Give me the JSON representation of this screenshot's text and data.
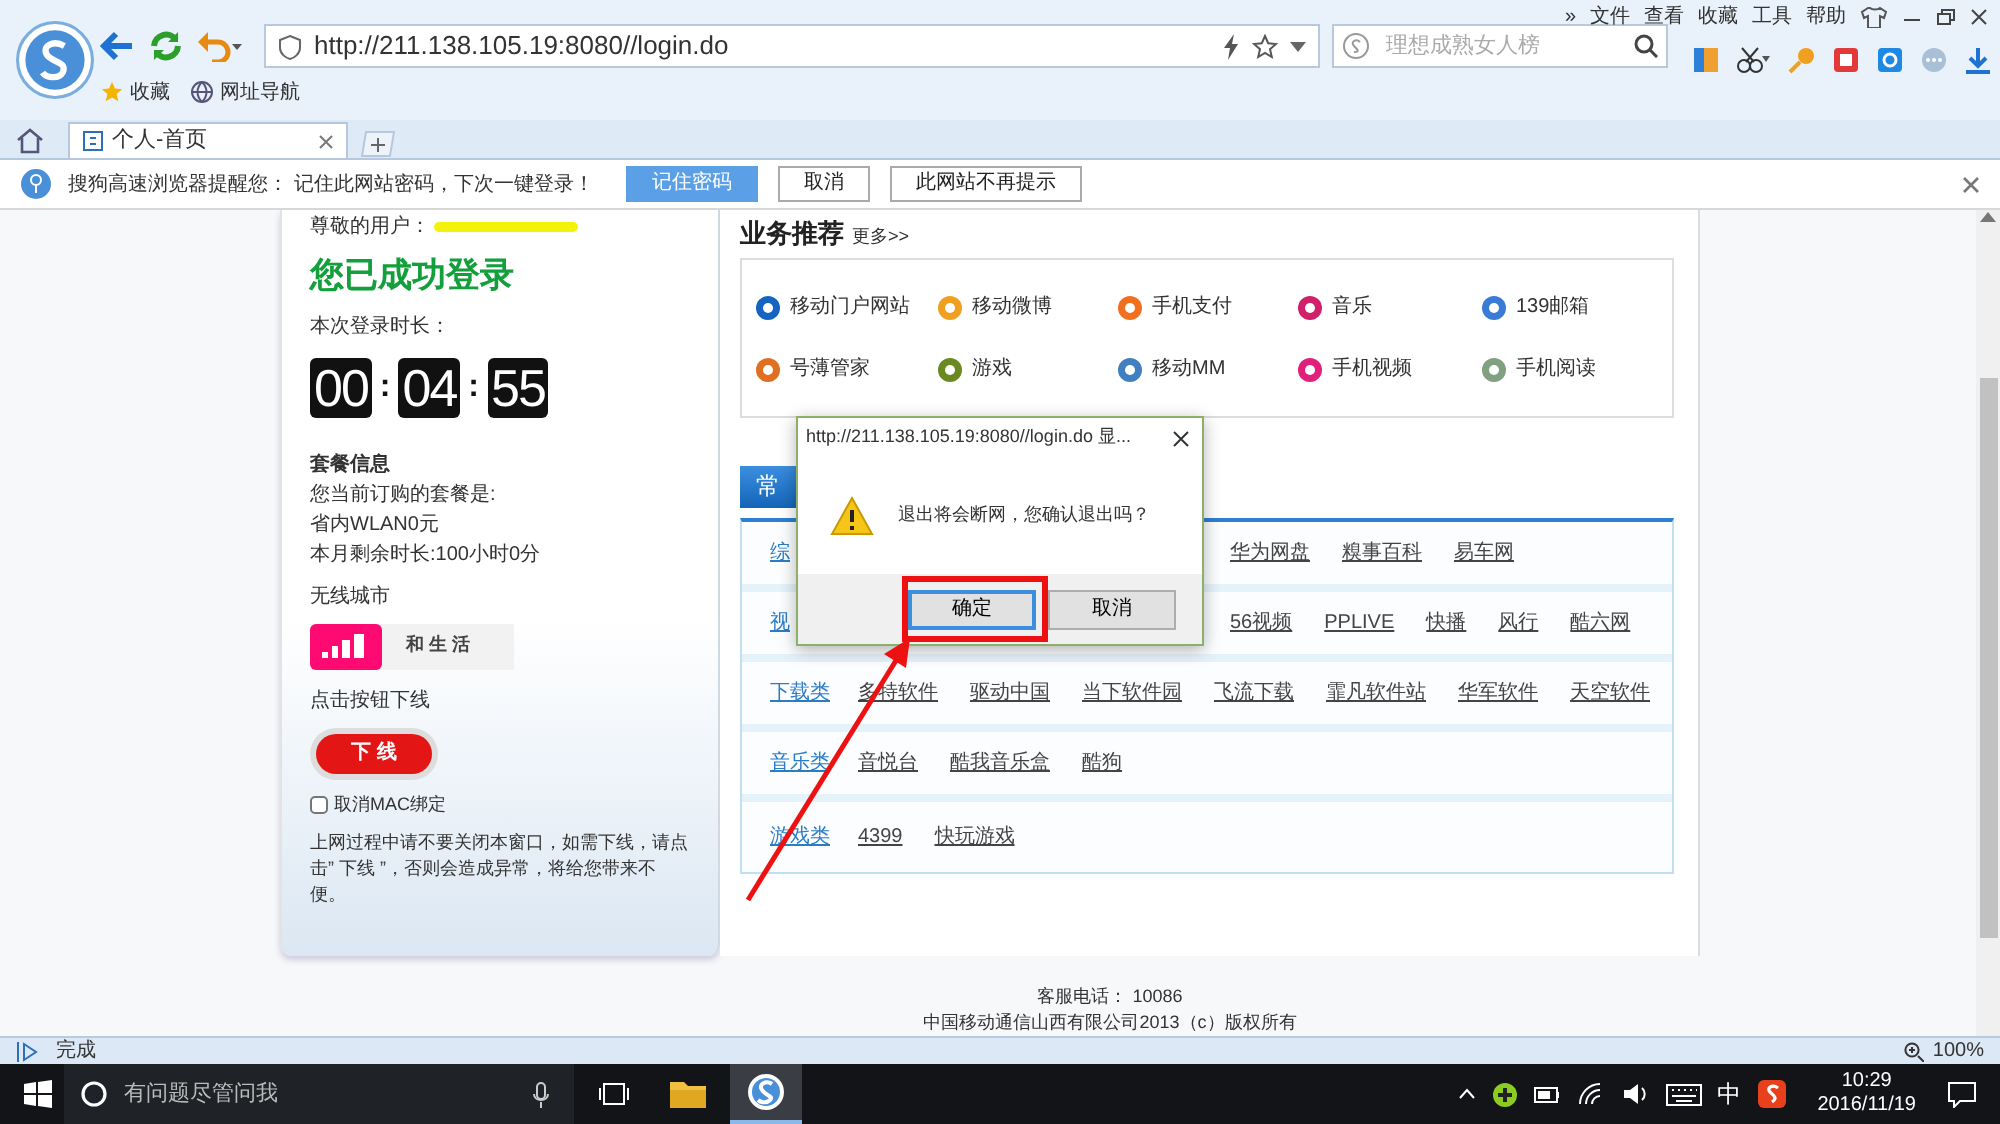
{
  "browser": {
    "address": "http://211.138.105.19:8080//login.do",
    "search_placeholder": "理想成熟女人榜",
    "menu": [
      "»",
      "文件",
      "查看",
      "收藏",
      "工具",
      "帮助"
    ],
    "bookmarks": [
      "收藏",
      "网址导航"
    ],
    "tabs": [
      {
        "label": "个人-首页",
        "selected": true
      }
    ]
  },
  "infobar": {
    "message": "搜狗高速浏览器提醒您：  记住此网站密码，下次一键登录！",
    "buttons": [
      {
        "label": "记住密码",
        "kind": "primary"
      },
      {
        "label": "取消",
        "kind": "plain"
      },
      {
        "label": "此网站不再提示",
        "kind": "plain"
      }
    ]
  },
  "account": {
    "user_label": "尊敬的用户：",
    "status": "您已成功登录",
    "duration_label": "本次登录时长：",
    "timer": [
      {
        "kind": "digits",
        "text": "00"
      },
      {
        "kind": "separator",
        "text": ":"
      },
      {
        "kind": "digits",
        "text": "04"
      },
      {
        "kind": "separator",
        "text": ":"
      },
      {
        "kind": "digits",
        "text": "55"
      }
    ],
    "plan_title": "套餐信息",
    "plan_lines": [
      "您当前订购的套餐是:",
      "省内WLAN0元",
      "本月剩余时长:100小时0分"
    ],
    "city_label": "无线城市",
    "banner": "和 生 活",
    "logout_hint": "点击按钮下线",
    "logout_button": "下 线",
    "mac_unbind": {
      "label": "取消MAC绑定",
      "checked": false
    },
    "notice": "上网过程中请不要关闭本窗口，如需下线，请点击” 下线 ”，否则会造成异常，将给您带来不便。"
  },
  "services": {
    "title": "业务推荐",
    "more": "更多>>",
    "items": [
      {
        "label": "移动门户网站",
        "color": "#1565c0"
      },
      {
        "label": "移动微博",
        "color": "#f0a020"
      },
      {
        "label": "手机支付",
        "color": "#f07020"
      },
      {
        "label": "音乐",
        "color": "#d0206a"
      },
      {
        "label": "139邮箱",
        "color": "#3a7bd5"
      },
      {
        "label": "号薄管家",
        "color": "#e07020"
      },
      {
        "label": "游戏",
        "color": "#6a8a20"
      },
      {
        "label": "移动MM",
        "color": "#4080c0"
      },
      {
        "label": "手机视频",
        "color": "#e0207a"
      },
      {
        "label": "手机阅读",
        "color": "#80a080"
      }
    ]
  },
  "sites": {
    "tab": "常",
    "rows": [
      {
        "label": "综",
        "covered": true,
        "links": [
          "华为网盘",
          "糗事百科",
          "易车网"
        ]
      },
      {
        "label": "视",
        "covered": true,
        "links": [
          "56视频",
          "PPLIVE",
          "快播",
          "风行",
          "酷六网"
        ]
      },
      {
        "label": "下载类",
        "covered": false,
        "links": [
          "多特软件",
          "驱动中国",
          "当下软件园",
          "飞流下载",
          "霏凡软件站",
          "华军软件",
          "天空软件"
        ]
      },
      {
        "label": "音乐类",
        "covered": false,
        "links": [
          "音悦台",
          "酷我音乐盒",
          "酷狗"
        ]
      },
      {
        "label": "游戏类",
        "covered": false,
        "links": [
          "4399",
          "快玩游戏"
        ]
      }
    ]
  },
  "footer": {
    "hotline": "客服电话： 10086",
    "copyright": "中国移动通信山西有限公司2013（c）版权所有"
  },
  "dialog": {
    "title": "http://211.138.105.19:8080//login.do 显...",
    "message": "退出将会断网，您确认退出吗？",
    "buttons": [
      {
        "label": "确定",
        "selected": true
      },
      {
        "label": "取消",
        "selected": false
      }
    ]
  },
  "status_bar": {
    "text": "完成",
    "zoom": "100%"
  },
  "taskbar": {
    "search_placeholder": "有问题尽管问我",
    "ime": "中",
    "time": "10:29",
    "date": "2016/11/19"
  }
}
